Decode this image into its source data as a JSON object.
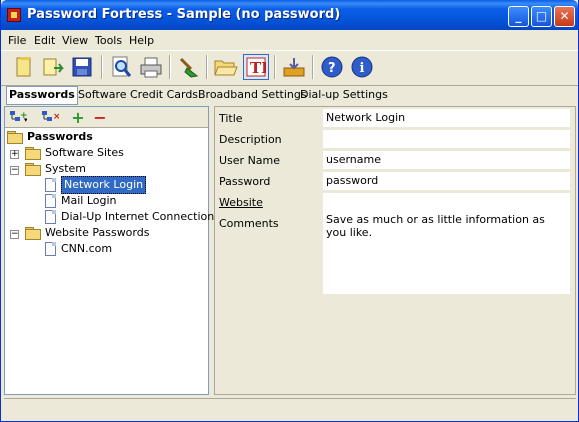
{
  "window": {
    "title": "Password Fortress - Sample (no password)"
  },
  "menu": [
    "File",
    "Edit",
    "View",
    "Tools",
    "Help"
  ],
  "toolbar_icons": [
    "new-file-icon",
    "open-file-icon",
    "save-icon",
    "preview-icon",
    "print-icon",
    "clean-icon",
    "open-folder-icon",
    "text-format-icon",
    "export-icon",
    "help-icon",
    "about-icon"
  ],
  "tabs": [
    "Passwords",
    "Software",
    "Credit Cards",
    "Broadband Settings",
    "Dial-up Settings"
  ],
  "tree": {
    "root": "Passwords",
    "groups": [
      {
        "label": "Software Sites",
        "children": []
      },
      {
        "label": "System",
        "children": [
          "Network Login",
          "Mail Login",
          "Dial-Up Internet Connection"
        ]
      },
      {
        "label": "Website Passwords",
        "children": [
          "CNN.com"
        ]
      }
    ]
  },
  "form": {
    "title_label": "Title",
    "title_value": "Network Login",
    "description_label": "Description",
    "description_value": "",
    "username_label": "User Name",
    "username_value": "username",
    "password_label": "Password",
    "password_value": "password",
    "website_label": "Website",
    "website_value": "",
    "comments_label": "Comments",
    "comments_value": "Save as much or as little information as you like."
  }
}
